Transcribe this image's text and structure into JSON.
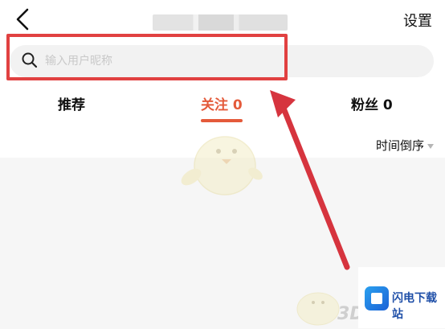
{
  "header": {
    "settings_label": "设置"
  },
  "search": {
    "placeholder": "输入用户昵称"
  },
  "tabs": [
    {
      "label": "推荐",
      "active": false
    },
    {
      "label": "关注 0",
      "active": true
    },
    {
      "label": "粉丝 0",
      "active": false
    }
  ],
  "sort": {
    "label": "时间倒序"
  },
  "watermark": {
    "site_name": "闪电下载站",
    "mark": "3D"
  },
  "colors": {
    "highlight": "#e14141",
    "active_tab": "#e45a3a",
    "badge_blue": "#1f4fa8"
  }
}
